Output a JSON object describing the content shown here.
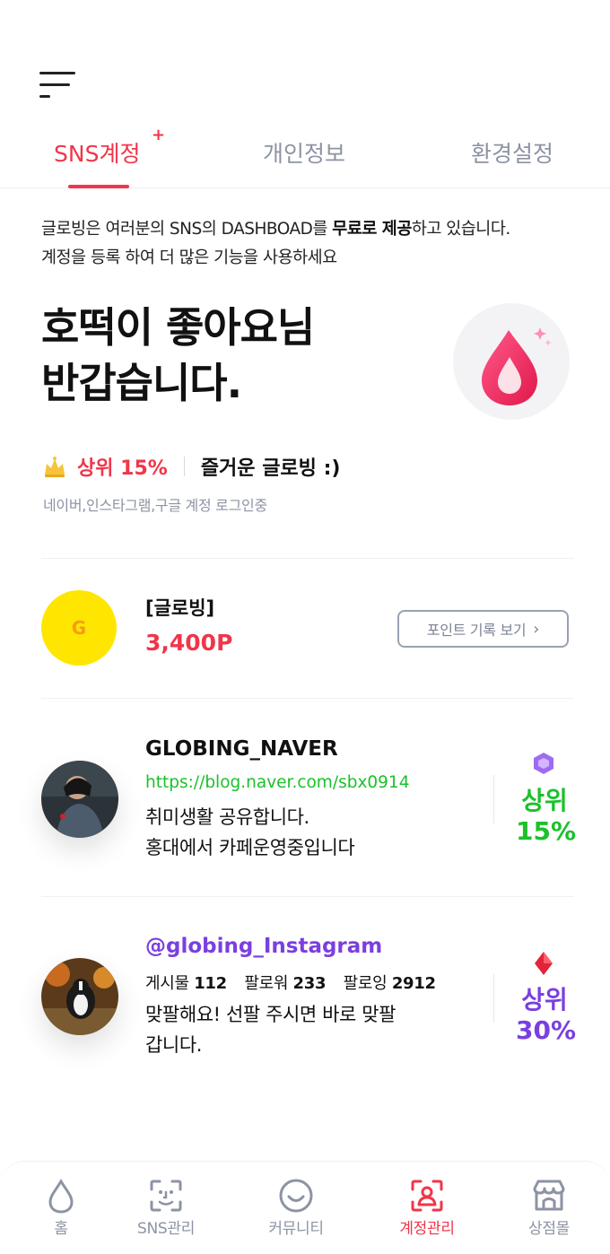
{
  "header": {
    "menu_icon": "hamburger-menu-icon"
  },
  "tabs": [
    {
      "label": "SNS계정",
      "active": true,
      "badge": "+"
    },
    {
      "label": "개인정보",
      "active": false
    },
    {
      "label": "환경설정",
      "active": false
    }
  ],
  "intro": {
    "line1_before": "글로빙은 여러분의 SNS의 DASHBOAD를 ",
    "line1_bold": "무료로 제공",
    "line1_after": "하고 있습니다.",
    "line2": "계정을 등록 하여 더 많은 기능을 사용하세요"
  },
  "greeting": {
    "line1": "호떡이 좋아요님",
    "line2": "반갑습니다."
  },
  "rank": {
    "text": "상위 15%",
    "message": "즐거운 글로빙 :)",
    "icon": "crown-icon"
  },
  "login_state": "네이버,인스타그램,구글 계정 로그인중",
  "points": {
    "coin_letter": "G",
    "name": "[글로빙]",
    "value": "3,400P",
    "history_button": "포인트 기록 보기",
    "chevron": "›"
  },
  "accounts": [
    {
      "name": "GLOBING_NAVER",
      "url": "https://blog.naver.com/sbx0914",
      "desc_line1": "취미생활 공유합니다.",
      "desc_line2": "홍대에서 카페운영중입니다",
      "rank_line1": "상위",
      "rank_line2": "15%",
      "rank_color": "#1bc12b",
      "badge_icon": "purple-gem-icon"
    },
    {
      "name": "@globing_Instagram",
      "stats": [
        {
          "label": "게시물",
          "value": "112"
        },
        {
          "label": "팔로워",
          "value": "233"
        },
        {
          "label": "팔로잉",
          "value": "2912"
        }
      ],
      "desc_line1": "맞팔해요! 선팔 주시면 바로 맞팔",
      "desc_line2": "갑니다.",
      "rank_line1": "상위",
      "rank_line2": "30%",
      "rank_color": "#7a3fe0",
      "name_color": "#7a3fe0",
      "badge_icon": "red-gem-icon"
    }
  ],
  "bottom_nav": [
    {
      "label": "홈",
      "icon": "drop-icon",
      "active": false
    },
    {
      "label": "SNS관리",
      "icon": "face-scan-icon",
      "active": false
    },
    {
      "label": "커뮤니티",
      "icon": "smile-icon",
      "active": false
    },
    {
      "label": "계정관리",
      "icon": "user-scan-icon",
      "active": true
    },
    {
      "label": "상점몰",
      "icon": "store-icon",
      "active": false
    }
  ],
  "colors": {
    "accent": "#f0364a",
    "naver_green": "#1bc12b",
    "insta_purple": "#7a3fe0",
    "muted": "#8c93a3"
  }
}
